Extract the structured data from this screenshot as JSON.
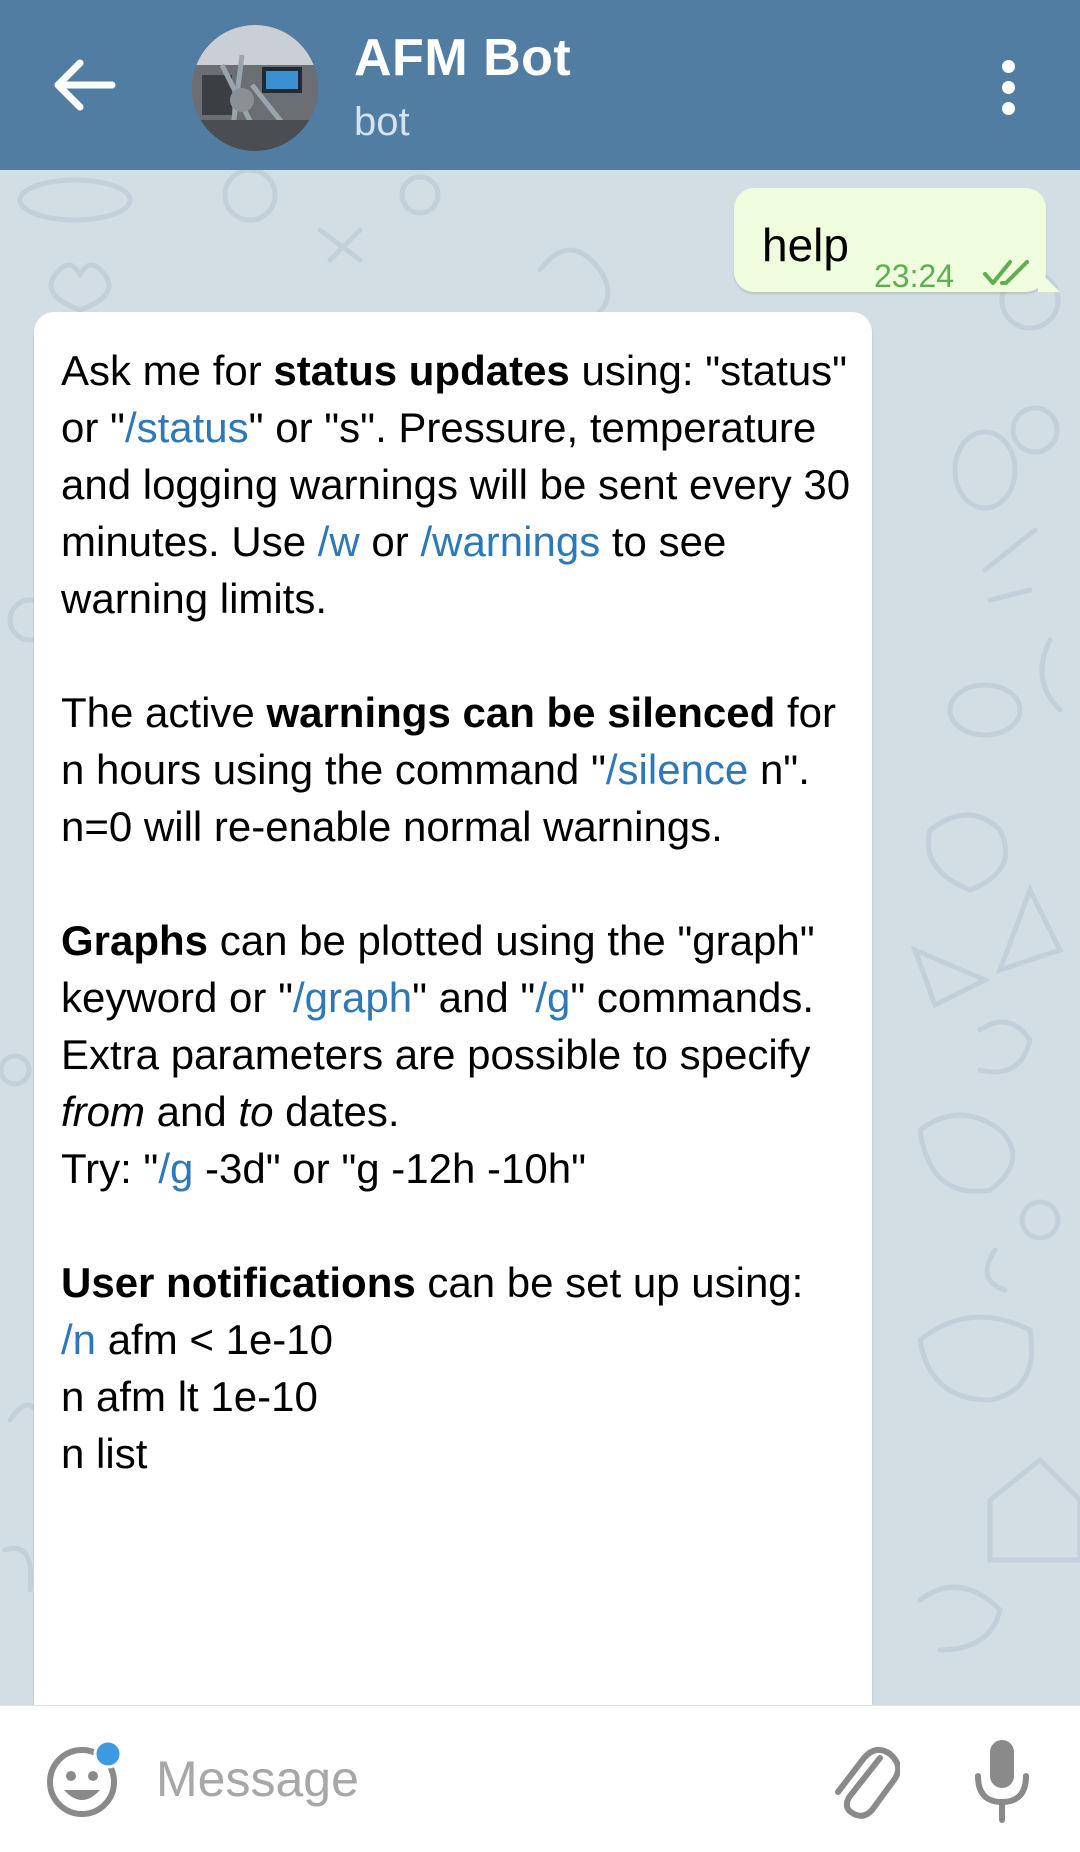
{
  "header": {
    "title": "AFM Bot",
    "subtitle": "bot",
    "back_icon": "arrow-left-icon",
    "menu_icon": "more-vertical-icon",
    "accent": "#527da3"
  },
  "messages": {
    "outgoing": {
      "text": "help",
      "time": "23:24",
      "status_icon": "double-check-icon"
    },
    "incoming": {
      "p1": {
        "a": "Ask me for ",
        "b": "status updates",
        "c": " using: \"status\" or \"",
        "link1": "/status",
        "d": "\" or \"s\". Pressure, temperature and logging warnings will be sent every 30 minutes. Use ",
        "link2": "/w",
        "e": " or ",
        "link3": "/warnings",
        "f": " to see warning limits."
      },
      "p2": {
        "a": "The active ",
        "b": "warnings can be silenced",
        "c": " for n hours using the command \"",
        "link1": "/silence",
        "d": " n\".",
        "e": "n=0 will re-enable normal warnings."
      },
      "p3": {
        "b": "Graphs",
        "a": " can be plotted using the \"graph\" keyword or \"",
        "link1": "/graph",
        "c": "\" and \"",
        "link2": "/g",
        "d": "\" commands. Extra parameters are possible to specify ",
        "i1": "from",
        "e": " and ",
        "i2": "to",
        "f": " dates.",
        "g": "Try: \"",
        "link3": "/g",
        "h": " -3d\" or \"g -12h -10h\""
      },
      "p4": {
        "b": "User notifications",
        "a": " can be set up using:",
        "link1": "/n",
        "c": " afm < 1e-10",
        "d": "n afm lt 1e-10",
        "e": "n list"
      }
    }
  },
  "input": {
    "placeholder": "Message",
    "emoji_icon": "emoji-icon",
    "attach_icon": "paperclip-icon",
    "mic_icon": "microphone-icon"
  }
}
